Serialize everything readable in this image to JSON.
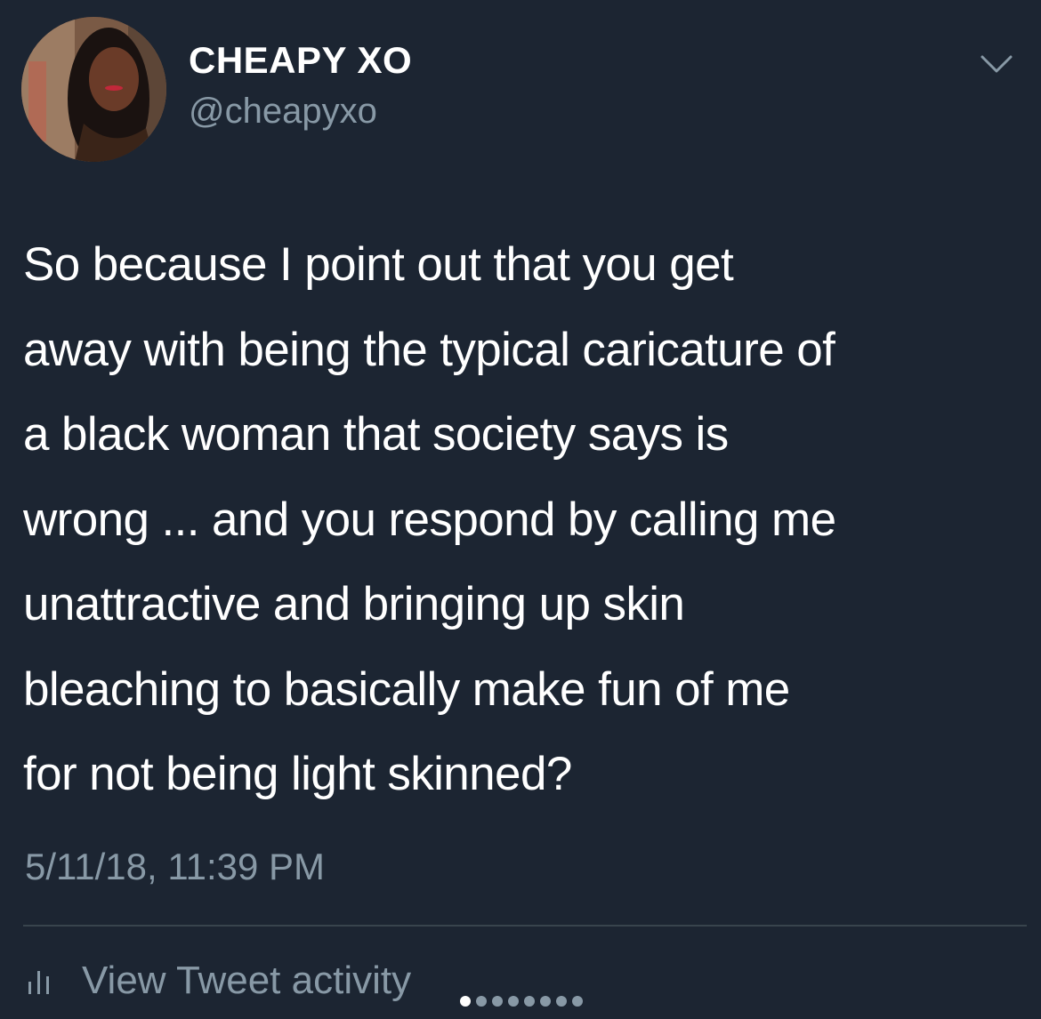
{
  "tweet": {
    "author": {
      "display_name": "CHEAPY XO",
      "handle": "@cheapyxo"
    },
    "text": "So because I point out that you get\naway with being the typical caricature of\na black woman that society says is\nwrong ... and you respond by calling me\nunattractive and bringing up skin\nbleaching to basically make fun of me\nfor not being light skinned?",
    "timestamp": "5/11/18, 11:39 PM",
    "activity_label": "View Tweet activity"
  },
  "pager": {
    "total": 8,
    "active_index": 0
  },
  "icons": {
    "menu": "chevron-down-icon",
    "activity": "bar-chart-icon"
  },
  "colors": {
    "background": "#1c2532",
    "primary_text": "#ffffff",
    "secondary_text": "#8899a6",
    "divider": "#38444d"
  }
}
